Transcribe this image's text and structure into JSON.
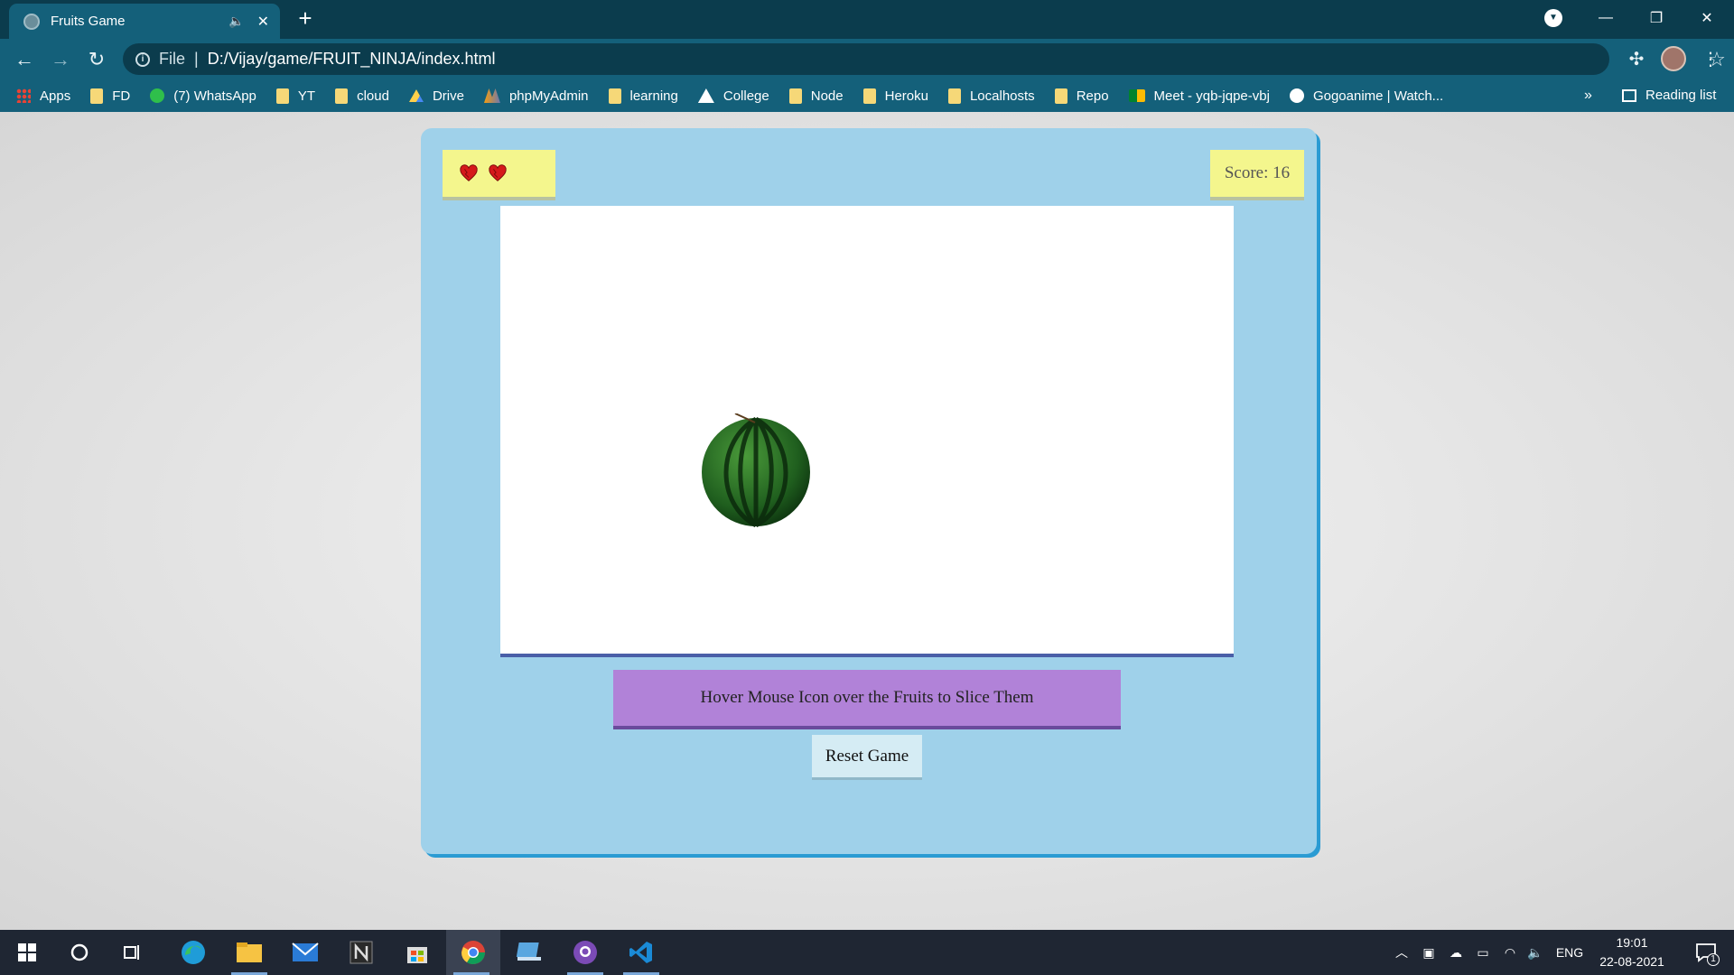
{
  "browser": {
    "tab_title": "Fruits Game",
    "url_protocol": "File",
    "url": "D:/Vijay/game/FRUIT_NINJA/index.html",
    "accent": "#14607a",
    "dark": "#0b3c4d"
  },
  "bookmarks": {
    "items": [
      {
        "label": "Apps",
        "icon": "apps-grid-icon"
      },
      {
        "label": "FD",
        "icon": "folder-icon"
      },
      {
        "label": "(7) WhatsApp",
        "icon": "whatsapp-icon"
      },
      {
        "label": "YT",
        "icon": "folder-icon"
      },
      {
        "label": "cloud",
        "icon": "folder-icon"
      },
      {
        "label": "Drive",
        "icon": "drive-icon"
      },
      {
        "label": "phpMyAdmin",
        "icon": "phpmyadmin-icon"
      },
      {
        "label": "learning",
        "icon": "folder-icon"
      },
      {
        "label": "College",
        "icon": "college-icon"
      },
      {
        "label": "Node",
        "icon": "folder-icon"
      },
      {
        "label": "Heroku",
        "icon": "folder-icon"
      },
      {
        "label": "Localhosts",
        "icon": "folder-icon"
      },
      {
        "label": "Repo",
        "icon": "folder-icon"
      },
      {
        "label": "Meet - yqb-jqpe-vbj",
        "icon": "meet-icon"
      },
      {
        "label": "Gogoanime | Watch...",
        "icon": "globe-icon"
      }
    ],
    "more": "»",
    "reading_list": "Reading list"
  },
  "game": {
    "lives": 2,
    "score_label": "Score: 16",
    "fruit": "watermelon",
    "instruction": "Hover Mouse Icon over the Fruits to Slice Them",
    "reset_label": "Reset Game",
    "panel_color": "#9fd1ea",
    "score_box_color": "#f4f68d",
    "instruction_color": "#b182d8"
  },
  "taskbar": {
    "apps": [
      "windows-start-icon",
      "search-icon",
      "task-view-icon",
      "edge-icon",
      "file-explorer-icon",
      "mail-icon",
      "notion-icon",
      "store-icon",
      "chrome-icon",
      "azure-data-studio-icon",
      "github-desktop-icon",
      "vscode-icon"
    ],
    "language": "ENG",
    "time": "19:01",
    "date": "22-08-2021",
    "notifications": "1"
  }
}
